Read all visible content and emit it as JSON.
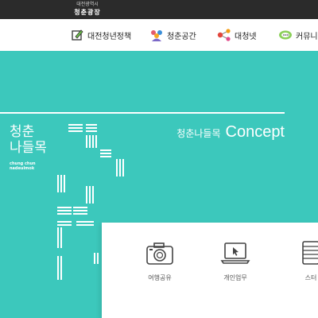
{
  "header": {
    "org_sub": "대전광역시",
    "org_name": "청춘광장"
  },
  "nav": {
    "items": [
      {
        "label": "대전청년정책",
        "icon": "policy-icon"
      },
      {
        "label": "청춘공간",
        "icon": "people-icon"
      },
      {
        "label": "대청넷",
        "icon": "network-icon"
      },
      {
        "label": "커뮤니",
        "icon": "chat-icon"
      }
    ]
  },
  "hero": {
    "title_line1": "청춘",
    "title_line2": "나들목",
    "romanized_line1": "chung chun",
    "romanized_line2": "nadeulmok",
    "concept_ko": "청춘나들목",
    "concept_en": "Concept",
    "bg_color": "#3cc8bc"
  },
  "services": {
    "items": [
      {
        "label": "여행공유",
        "icon": "camera-icon"
      },
      {
        "label": "개인업무",
        "icon": "laptop-icon"
      },
      {
        "label": "스터",
        "icon": "books-icon"
      }
    ]
  }
}
